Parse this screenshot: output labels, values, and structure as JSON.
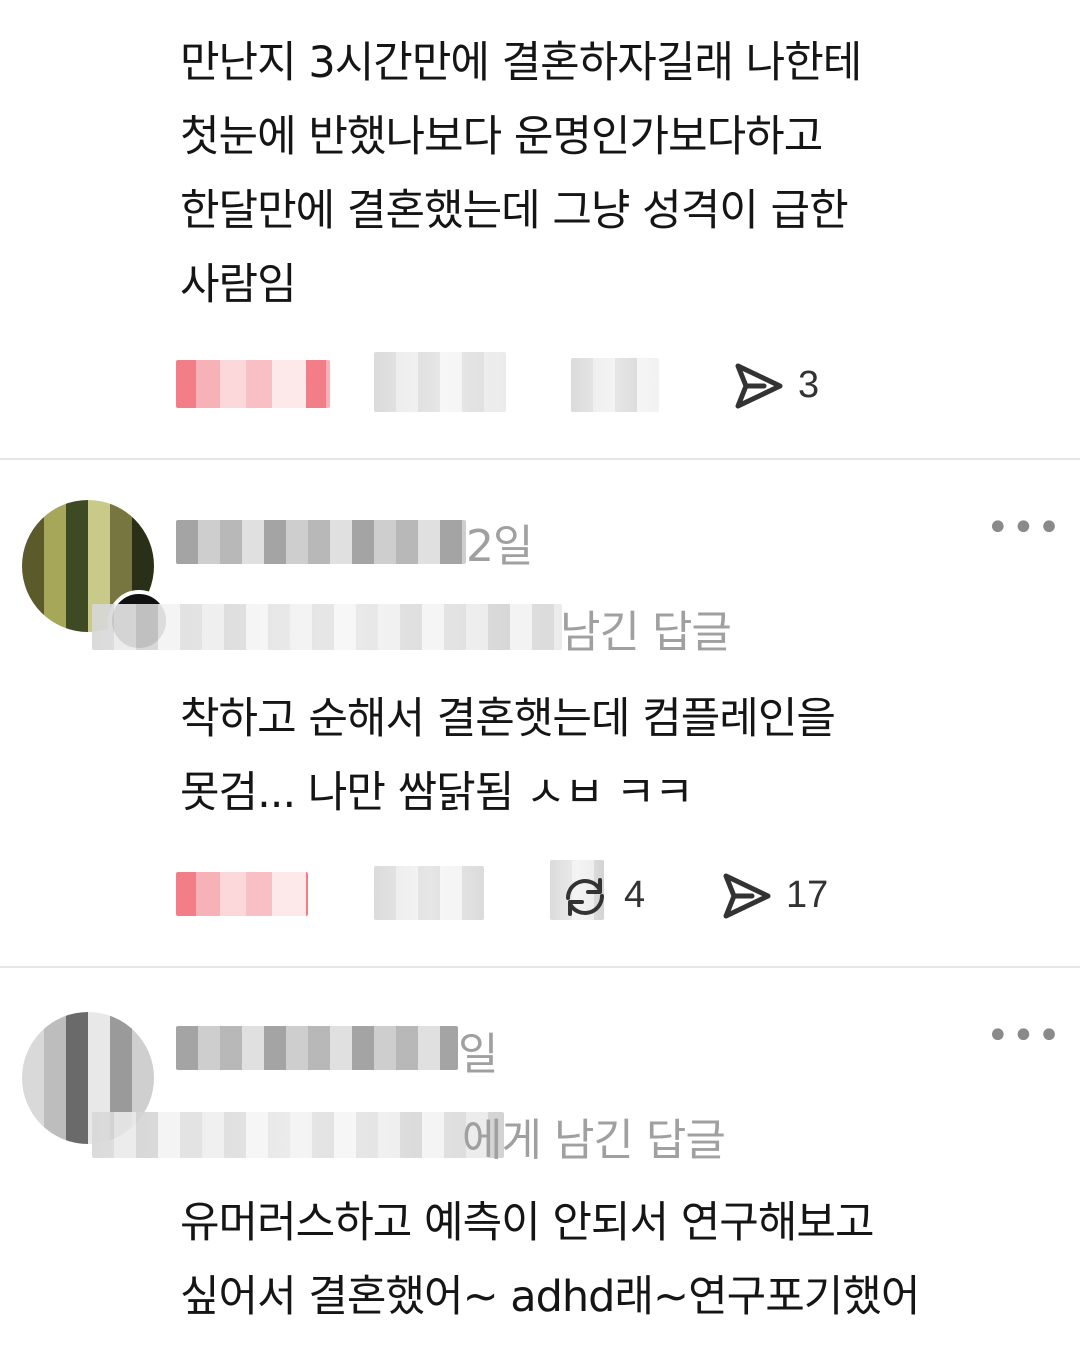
{
  "posts": [
    {
      "text": "만난지 3시간만에 결혼하자길래 나한테\n첫눈에 반했나보다 운명인가보다하고\n한달만에 결혼했는데 그냥 성격이 급한\n사람임",
      "share_count": "3"
    },
    {
      "date": "2일",
      "reply_label": "남긴 답글",
      "text": "착하고 순해서 결혼햇는데 컴플레인을\n못검... 나만 쌈닭됨 ㅅㅂ ㅋㅋ",
      "repost_count": "4",
      "share_count": "17"
    },
    {
      "date": "일",
      "reply_label": "에게 남긴 답글",
      "text": "유머러스하고 예측이 안되서 연구해보고\n싶어서 결혼했어~ adhd래~연구포기했어"
    }
  ],
  "icons": {
    "share": "share-arrow-icon",
    "repost": "repost-icon",
    "more": "more-options-icon"
  }
}
